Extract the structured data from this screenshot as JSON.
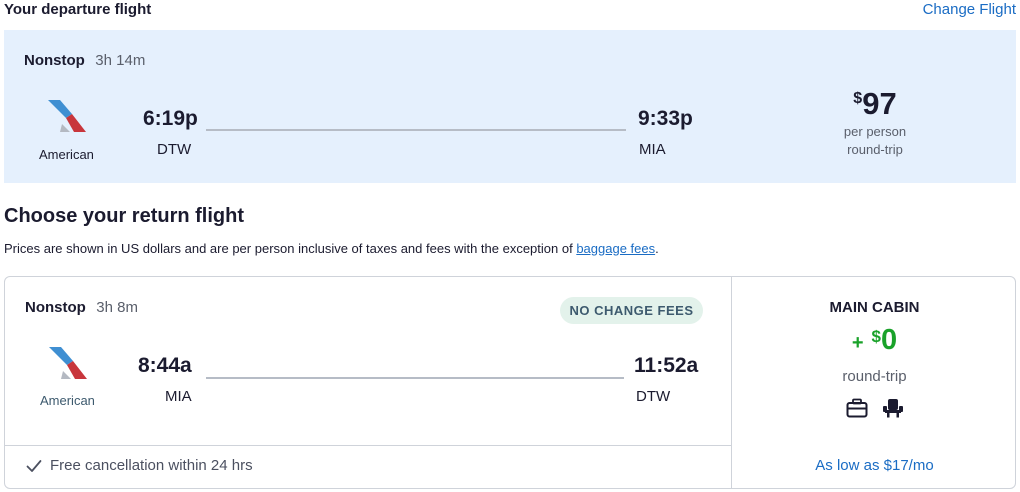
{
  "departure": {
    "section_title": "Your departure flight",
    "change_link": "Change Flight",
    "stops": "Nonstop",
    "duration": "3h 14m",
    "airline": "American",
    "depart_time": "6:19p",
    "depart_airport": "DTW",
    "arrive_time": "9:33p",
    "arrive_airport": "MIA",
    "price_symbol": "$",
    "price_value": "97",
    "price_basis": "per person",
    "trip_type": "round-trip"
  },
  "return": {
    "section_title": "Choose your return flight",
    "note_prefix": "Prices are shown in US dollars and are per person inclusive of taxes and fees with the exception of ",
    "note_link": "baggage fees",
    "note_suffix": ".",
    "stops": "Nonstop",
    "duration": "3h 8m",
    "badge": "NO CHANGE FEES",
    "airline": "American",
    "depart_time": "8:44a",
    "depart_airport": "MIA",
    "arrive_time": "11:52a",
    "arrive_airport": "DTW",
    "cancellation": "Free cancellation within 24 hrs",
    "cabin": {
      "name": "MAIN CABIN",
      "plus_sign": "+",
      "price_symbol": "$",
      "price_value": "0",
      "trip_type": "round-trip",
      "amenities": [
        "carry-on-bag-icon",
        "seat-icon"
      ],
      "monthly": "As low as $17/mo"
    }
  },
  "colors": {
    "accent_blue": "#1a6cc4",
    "card_bg": "#e5f0fd",
    "price_green": "#1aa22a",
    "badge_bg": "#e3f2eb",
    "airline_red": "#c8363c",
    "airline_blue": "#3f8fd2"
  }
}
